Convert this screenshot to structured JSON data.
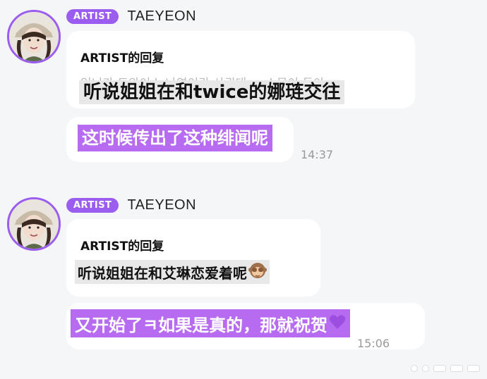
{
  "messages": [
    {
      "badge": "ARTIST",
      "name": "TAEYEON",
      "reply_label": "ARTIST的回复",
      "faded_text": "언니가 트와이스 나연이랑 사귄대 ... 소문이 돌아",
      "quoted_text": "听说姐姐在和twice的娜琏交往",
      "answer_text": "这时候传出了这种绯闻呢",
      "time": "14:37"
    },
    {
      "badge": "ARTIST",
      "name": "TAEYEON",
      "reply_label": "ARTIST的回复",
      "quoted_text": "听说姐姐在和艾琳恋爱着呢",
      "answer_text": "又开始了ㅋ如果是真的，那就祝贺",
      "time": "15:06"
    }
  ],
  "icons": {
    "monkey": "see-no-evil-monkey-icon",
    "heart": "purple-heart-icon"
  },
  "colors": {
    "badge": "#9b5cf0",
    "highlight_purple": "#b66bf0",
    "quote_highlight": "#e8e8e8"
  }
}
